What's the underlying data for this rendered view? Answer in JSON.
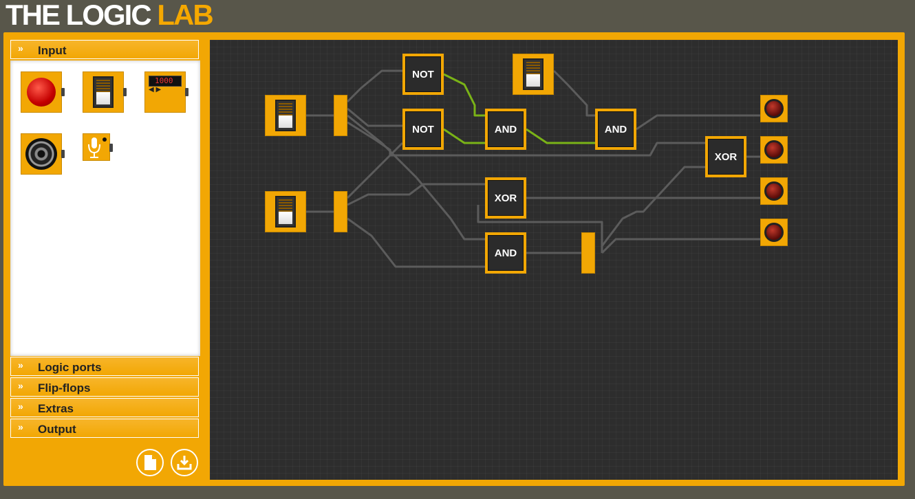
{
  "app": {
    "title_main": "THE LOGIC ",
    "title_accent": "LAB"
  },
  "sidebar": {
    "sections": [
      {
        "label": "Input",
        "chevron": "»"
      },
      {
        "label": "Logic ports",
        "chevron": "»"
      },
      {
        "label": "Flip-flops",
        "chevron": "»"
      },
      {
        "label": "Extras",
        "chevron": "»"
      },
      {
        "label": "Output",
        "chevron": "»"
      }
    ],
    "input_components": [
      {
        "name": "push-button",
        "icon": "red-button-icon"
      },
      {
        "name": "toggle-switch",
        "icon": "switch-icon"
      },
      {
        "name": "clock-counter",
        "icon": "counter-icon",
        "display": "1000",
        "arrows": "◀ ▶"
      },
      {
        "name": "speaker-input",
        "icon": "speaker-icon"
      },
      {
        "name": "microphone-input",
        "icon": "microphone-icon"
      }
    ],
    "actions": [
      {
        "name": "new-file",
        "icon": "document-icon"
      },
      {
        "name": "download",
        "icon": "download-icon"
      }
    ]
  },
  "canvas": {
    "gates": [
      {
        "id": "not1",
        "label": "NOT"
      },
      {
        "id": "not2",
        "label": "NOT"
      },
      {
        "id": "and1",
        "label": "AND"
      },
      {
        "id": "and2",
        "label": "AND"
      },
      {
        "id": "xor1",
        "label": "XOR"
      },
      {
        "id": "xor2",
        "label": "XOR"
      },
      {
        "id": "and3",
        "label": "AND"
      }
    ]
  },
  "colors": {
    "accent": "#f2a704",
    "canvas": "#2d2d2d",
    "wire": "#5a5a5a",
    "active_wire": "#7ab317",
    "lamp_off": "#6b0f0c"
  }
}
